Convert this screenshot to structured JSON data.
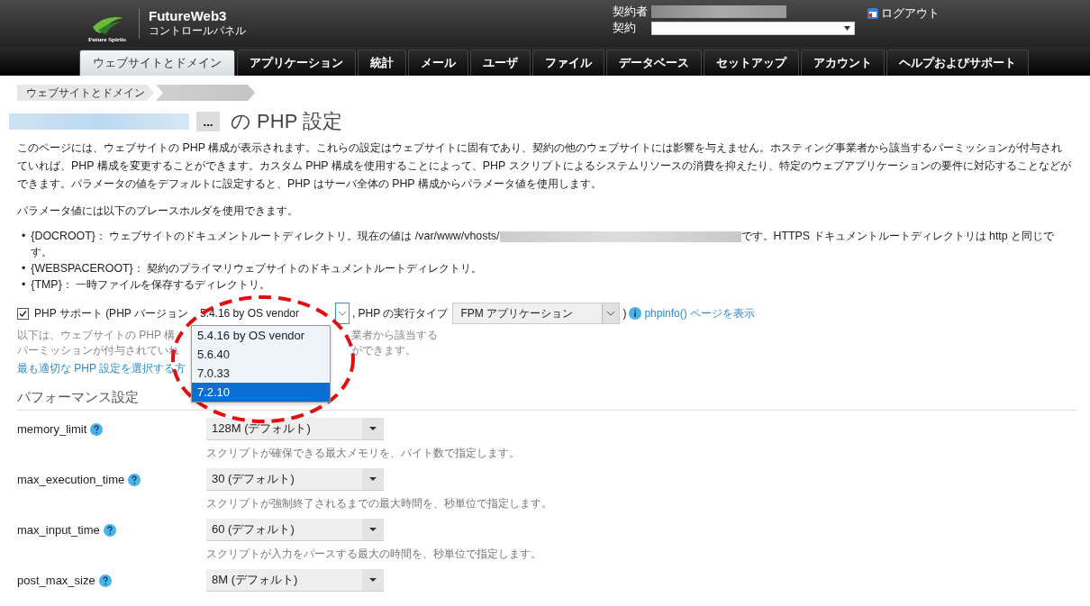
{
  "header": {
    "logo_text": "Future Spirits",
    "product": "FutureWeb3",
    "subtitle": "コントロールパネル",
    "owner_label": "契約者",
    "subscription_label": "契約",
    "logout": "ログアウト"
  },
  "tabs": [
    {
      "label": "ウェブサイトとドメイン",
      "selected": true
    },
    {
      "label": "アプリケーション",
      "selected": false
    },
    {
      "label": "統計",
      "selected": false
    },
    {
      "label": "メール",
      "selected": false
    },
    {
      "label": "ユーザ",
      "selected": false
    },
    {
      "label": "ファイル",
      "selected": false
    },
    {
      "label": "データベース",
      "selected": false
    },
    {
      "label": "セットアップ",
      "selected": false
    },
    {
      "label": "アカウント",
      "selected": false
    },
    {
      "label": "ヘルプおよびサポート",
      "selected": false
    }
  ],
  "breadcrumb": [
    "ウェブサイトとドメイン"
  ],
  "title": {
    "more": "...",
    "text": "の PHP 設定"
  },
  "intro": "このページには、ウェブサイトの PHP 構成が表示されます。これらの設定はウェブサイトに固有であり、契約の他のウェブサイトには影響を与えません。ホスティング事業者から該当するパーミッションが付与されていれば、PHP 構成を変更することができます。カスタム PHP 構成を使用することによって、PHP スクリプトによるシステムリソースの消費を抑えたり、特定のウェブアプリケーションの要件に対応することなどができます。パラメータの値をデフォルトに設定すると、PHP はサーバ全体の PHP 構成からパラメータ値を使用します。",
  "placeholders_intro": "パラメータ値には以下のプレースホルダを使用できます。",
  "placeholders": [
    {
      "marker": "•",
      "name": "{DOCROOT}：",
      "before": "ウェブサイトのドキュメントルートディレクトリ。現在の値は /var/www/vhosts/",
      "after": "です。HTTPS ドキュメントルートディレクトリは http と同じです。"
    },
    {
      "marker": "•",
      "name": "{WEBSPACEROOT}：",
      "before": "契約のプライマリウェブサイトのドキュメントルートディレクトリ。"
    },
    {
      "marker": "•",
      "name": "{TMP}：",
      "before": "一時ファイルを保存するディレクトリ。"
    }
  ],
  "php_support": {
    "checked": true,
    "label": "PHP サポート (PHP バージョン",
    "version": "5.4.16 by OS vendor",
    "mode_label": ", PHP の実行タイプ",
    "mode": "FPM アプリケーション",
    "close": ")",
    "phpinfo_link": "phpinfo() ページを表示",
    "version_options": [
      {
        "label": "5.4.16 by OS vendor",
        "selected": false
      },
      {
        "label": "5.6.40",
        "selected": false
      },
      {
        "label": "7.0.33",
        "selected": false
      },
      {
        "label": "7.2.10",
        "selected": true
      }
    ]
  },
  "php_note_lines": [
    {
      "left": "以下は、ウェブサイトの PHP 構",
      "right": "業者から該当する"
    },
    {
      "left": "パーミッションが付与されていれ",
      "right": "ができます。"
    }
  ],
  "php_help_link": "最も適切な PHP 設定を選択する方",
  "performance": {
    "heading": "パフォーマンス設定",
    "settings": [
      {
        "name": "memory_limit",
        "value": "128M (デフォルト)",
        "description": "スクリプトが確保できる最大メモリを、バイト数で指定します。"
      },
      {
        "name": "max_execution_time",
        "value": "30 (デフォルト)",
        "description": "スクリプトが強制終了されるまでの最大時間を、秒単位で指定します。"
      },
      {
        "name": "max_input_time",
        "value": "60 (デフォルト)",
        "description": "スクリプトが入力をパースする最大の時間を、秒単位で指定します。"
      },
      {
        "name": "post_max_size",
        "value": "8M (デフォルト)"
      }
    ]
  }
}
